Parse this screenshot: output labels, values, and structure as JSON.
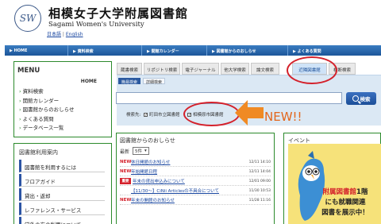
{
  "header": {
    "logo_text": "SW",
    "title_jp": "相模女子大学附属図書館",
    "title_en": "Sagami Women's University",
    "lang_jp": "日本語",
    "lang_en": "English"
  },
  "nav": {
    "items": [
      "HOME",
      "資料検索",
      "開館カレンダー",
      "図書館からのおしらせ",
      "よくある質問"
    ]
  },
  "search": {
    "tabs": [
      "蔵書検索",
      "リポジトリ検索",
      "電子ジャーナル",
      "他大学検索",
      "論文検索",
      "近隣図書館",
      "横断検索"
    ],
    "active_tab": "近隣図書館",
    "subtabs": [
      "簡易検索",
      "詳細検索"
    ],
    "input_value": "",
    "button_label": "検索",
    "target_label": "検索先:",
    "targets": [
      {
        "label": "町田市立図書館",
        "checked": true
      },
      {
        "label": "相模原市図書館",
        "checked": true
      }
    ],
    "new_label": "NEW!!"
  },
  "menu": {
    "title": "MENU",
    "home_label": "HOME",
    "items": [
      "資料検索",
      "開館カレンダー",
      "図書館からのおしらせ",
      "よくある質問",
      "データベース一覧"
    ]
  },
  "guide": {
    "title": "図書館利用案内",
    "items": [
      "図書館を利用するには",
      "フロアガイド",
      "貸出・返却",
      "レファレンス・サービス",
      "学外の方の利用について"
    ]
  },
  "news": {
    "title": "図書館からのおしらせ",
    "recent_label": "最新",
    "count_value": "5件",
    "rows": [
      {
        "badge": "NEW",
        "badge_type": "text",
        "text": "休日開館のお知らせ",
        "date": "12/11 14:10"
      },
      {
        "badge": "NEW",
        "badge_type": "text",
        "text": "年始開館日程",
        "date": "12/11 14:04"
      },
      {
        "badge": "重要",
        "badge_type": "box",
        "text": "年末の貸出申込みについて",
        "date": "12/01 09:00"
      },
      {
        "badge": "",
        "badge_type": "none",
        "text": "【11/30〜】CiNii Articlesの不具合について",
        "date": "11/30 10:53"
      },
      {
        "badge": "NEW",
        "badge_type": "text",
        "text": "年末の開館のお知らせ",
        "date": "11/28 11:16"
      }
    ]
  },
  "event": {
    "title": "イベント",
    "line1_hl": "附属図書館",
    "line1_rest": "1階",
    "line2": "にも就職関連",
    "line3": "図書を展示中！"
  },
  "colors": {
    "nav_blue": "#1c5699",
    "box_green": "#2c8a2c",
    "highlight_red": "#d4212b",
    "new_orange": "#e3661c",
    "panel_blue": "#dbe8f4"
  }
}
